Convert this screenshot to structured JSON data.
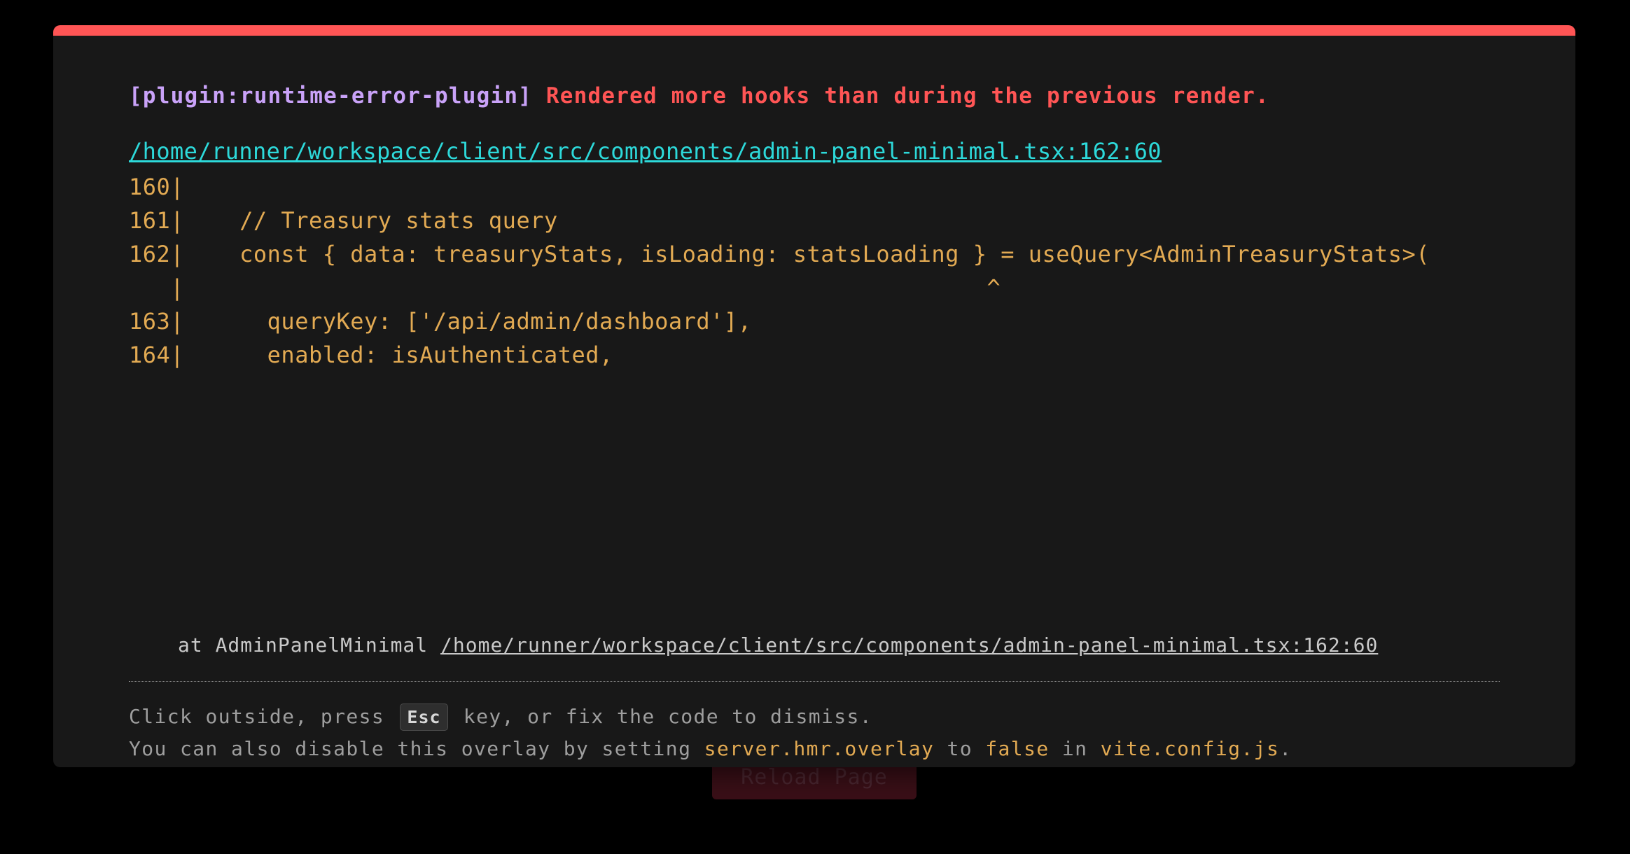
{
  "background_button": {
    "label": "Reload Page",
    "color": "#3a0f17"
  },
  "overlay": {
    "accent_color": "#ff5555",
    "background": "#181818",
    "plugin": "[plugin:runtime-error-plugin]",
    "message": "Rendered more hooks than during the previous render.",
    "file": "/home/runner/workspace/client/src/components/admin-panel-minimal.tsx:162:60",
    "frame_lines": [
      "160|",
      "161|    // Treasury stats query",
      "162|    const { data: treasuryStats, isLoading: statsLoading } = useQuery<AdminTreasuryStats>(",
      "   |                                                          ^",
      "163|      queryKey: ['/api/admin/dashboard'],",
      "164|      enabled: isAuthenticated,"
    ],
    "stack": {
      "prefix": "at AdminPanelMinimal ",
      "link": "/home/runner/workspace/client/src/components/admin-panel-minimal.tsx:162:60"
    },
    "tip": {
      "line1_before": "Click outside, press ",
      "key": "Esc",
      "line1_after": " key, or fix the code to dismiss.",
      "line2_text1": "You can also disable this overlay by setting ",
      "line2_code1": "server.hmr.overlay",
      "line2_text2": " to ",
      "line2_code2": "false",
      "line2_text3": " in ",
      "line2_code3": "vite.config.js",
      "line2_text4": "."
    }
  }
}
